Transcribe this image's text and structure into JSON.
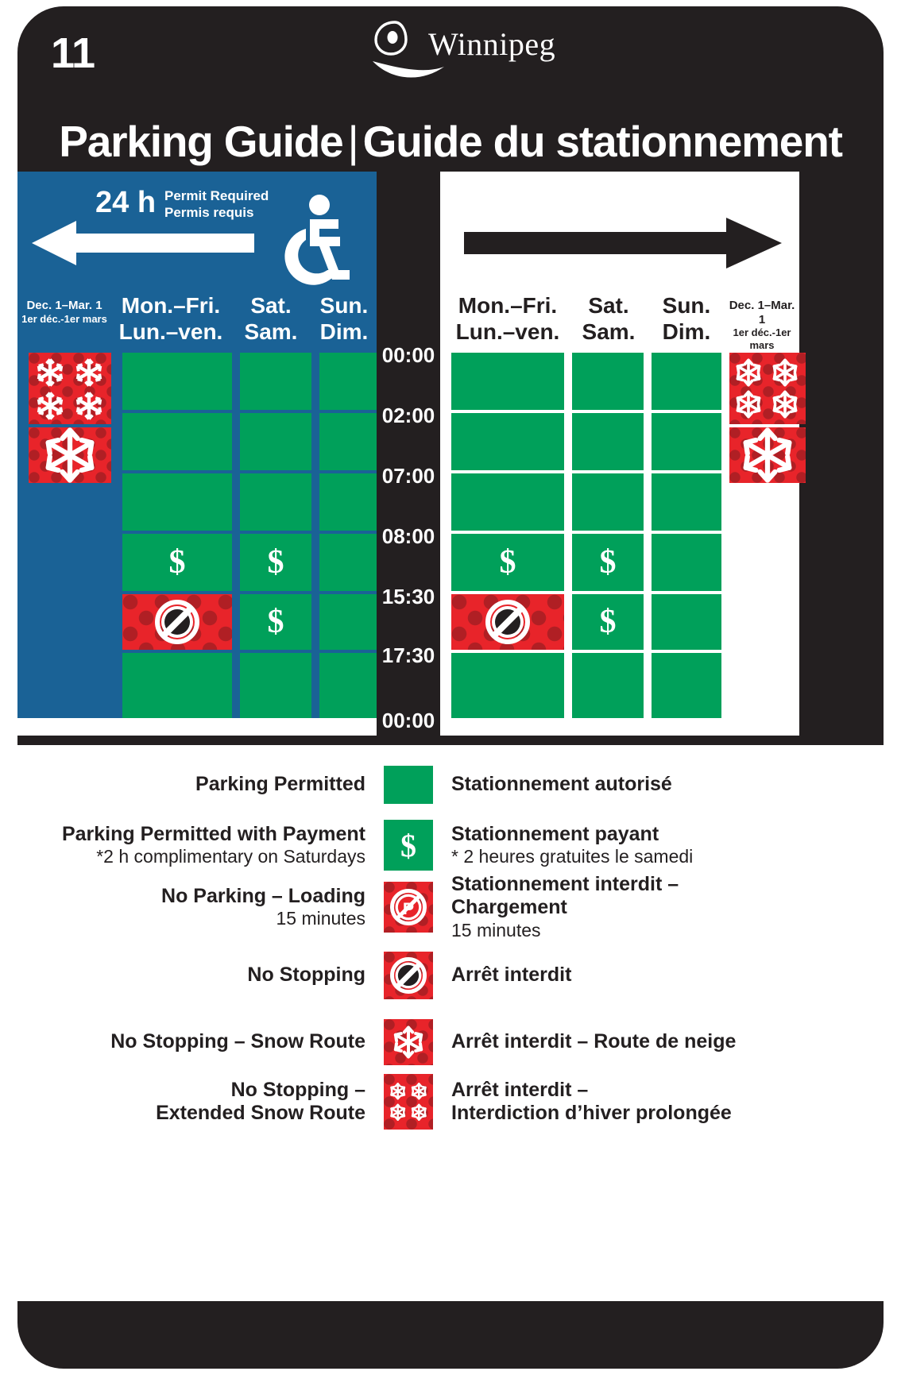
{
  "sign": {
    "number": "11",
    "logo_text": "Winnipeg",
    "logo_icon": "winnipeg-swoosh-logo",
    "title_en": "Parking Guide",
    "title_separator": "|",
    "title_fr": "Guide du stationnement",
    "accent_blue": "#1a6296",
    "accent_green": "#00a05a",
    "accent_red": "#e8242a",
    "background": "#231f20"
  },
  "left_panel": {
    "direction_icon": "arrow-left",
    "hours_label": "24 h",
    "permit_en": "Permit Required",
    "permit_fr": "Permis requis",
    "accessibility_icon": "wheelchair-icon",
    "columns": [
      {
        "header_en": "Dec. 1–Mar. 1",
        "header_fr": "1er déc.-1er mars",
        "size": "small"
      },
      {
        "header_en": "Mon.–Fri.",
        "header_fr": "Lun.–ven.",
        "size": "big"
      },
      {
        "header_en": "Sat.",
        "header_fr": "Sam.",
        "size": "big"
      },
      {
        "header_en": "Sun.",
        "header_fr": "Dim.",
        "size": "big"
      }
    ]
  },
  "right_panel": {
    "direction_icon": "arrow-right",
    "columns": [
      {
        "header_en": "Mon.–Fri.",
        "header_fr": "Lun.–ven.",
        "size": "big"
      },
      {
        "header_en": "Sat.",
        "header_fr": "Sam.",
        "size": "big"
      },
      {
        "header_en": "Sun.",
        "header_fr": "Dim.",
        "size": "big"
      },
      {
        "header_en": "Dec. 1–Mar. 1",
        "header_fr": "1er déc.-1er mars",
        "size": "small"
      }
    ]
  },
  "time_axis": {
    "labels": [
      "00:00",
      "02:00",
      "07:00",
      "08:00",
      "15:30",
      "17:30",
      "00:00"
    ]
  },
  "chart_data": {
    "type": "table",
    "title": "Parking Guide | Guide du stationnement",
    "time_boundaries": [
      "00:00",
      "02:00",
      "07:00",
      "08:00",
      "15:30",
      "17:30",
      "00:00"
    ],
    "row_bands": [
      {
        "from": "00:00",
        "to": "02:00"
      },
      {
        "from": "02:00",
        "to": "07:00"
      },
      {
        "from": "07:00",
        "to": "08:00"
      },
      {
        "from": "08:00",
        "to": "15:30"
      },
      {
        "from": "15:30",
        "to": "17:30"
      },
      {
        "from": "17:30",
        "to": "00:00"
      }
    ],
    "left_side": {
      "label": "Left side of street (arrow-left) — 24 h Permit Required",
      "series": [
        {
          "name": "Dec. 1–Mar. 1",
          "values": [
            "snow-extended",
            "snow-route",
            "none",
            "none",
            "none",
            "none"
          ]
        },
        {
          "name": "Mon.–Fri.",
          "values": [
            "permitted",
            "permitted",
            "permitted",
            "paid",
            "no-stopping",
            "permitted"
          ]
        },
        {
          "name": "Sat.",
          "values": [
            "permitted",
            "permitted",
            "permitted",
            "paid",
            "paid",
            "permitted"
          ]
        },
        {
          "name": "Sun.",
          "values": [
            "permitted",
            "permitted",
            "permitted",
            "permitted",
            "permitted",
            "permitted"
          ]
        }
      ]
    },
    "right_side": {
      "label": "Right side of street (arrow-right)",
      "series": [
        {
          "name": "Mon.–Fri.",
          "values": [
            "permitted",
            "permitted",
            "permitted",
            "paid",
            "no-stopping",
            "permitted"
          ]
        },
        {
          "name": "Sat.",
          "values": [
            "permitted",
            "permitted",
            "permitted",
            "paid",
            "paid",
            "permitted"
          ]
        },
        {
          "name": "Sun.",
          "values": [
            "permitted",
            "permitted",
            "permitted",
            "permitted",
            "permitted",
            "permitted"
          ]
        },
        {
          "name": "Dec. 1–Mar. 1",
          "values": [
            "snow-extended",
            "snow-route",
            "none",
            "none",
            "none",
            "none"
          ]
        }
      ]
    },
    "state_legend": {
      "permitted": "Parking Permitted / Stationnement autorisé",
      "paid": "Parking Permitted with Payment / Stationnement payant",
      "no-stopping": "No Stopping / Arrêt interdit",
      "snow-route": "No Stopping – Snow Route / Arrêt interdit – Route de neige",
      "snow-extended": "No Stopping – Extended Snow Route / Arrêt interdit – Interdiction d’hiver prolongée"
    }
  },
  "legend": {
    "items": [
      {
        "en_main": "Parking Permitted",
        "en_sub": "",
        "fr_main": "Stationnement autorisé",
        "fr_sub": "",
        "icon": "green-block-icon"
      },
      {
        "en_main": "Parking Permitted with Payment",
        "en_sub": "*2 h complimentary on Saturdays",
        "fr_main": "Stationnement payant",
        "fr_sub": "* 2 heures gratuites le samedi",
        "icon": "dollar-sign-icon"
      },
      {
        "en_main": "No Parking – Loading",
        "en_sub": "15 minutes",
        "fr_main": "Stationnement interdit – Chargement",
        "fr_sub": "15 minutes",
        "icon": "no-parking-icon"
      },
      {
        "en_main": "No Stopping",
        "en_sub": "",
        "fr_main": "Arrêt interdit",
        "fr_sub": "",
        "icon": "no-stopping-icon"
      },
      {
        "en_main": "No Stopping – Snow Route",
        "en_sub": "",
        "fr_main": "Arrêt interdit – Route de neige",
        "fr_sub": "",
        "icon": "snowflake-icon"
      },
      {
        "en_main": "No Stopping –",
        "en_sub": "Extended Snow Route",
        "fr_main": "Arrêt interdit –",
        "fr_sub": "Interdiction d’hiver prolongée",
        "icon": "four-snowflakes-icon"
      }
    ]
  }
}
